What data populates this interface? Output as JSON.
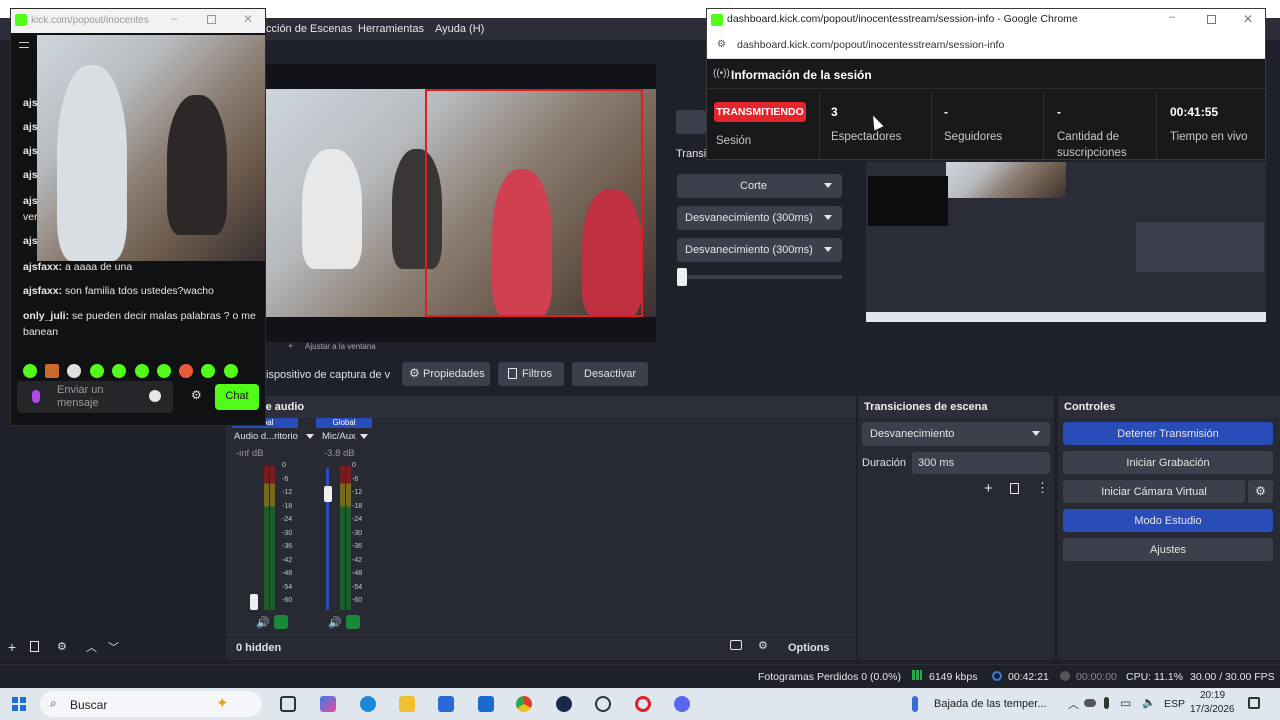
{
  "obs_menu": {
    "items": [
      "cción de Escenas",
      "Herramientas",
      "Ayuda (H)"
    ]
  },
  "chat_window": {
    "url": "kick.com/popout/inocentes",
    "messages": [
      {
        "user": "ajsfaxx:",
        "text": "a aaaa de una"
      },
      {
        "user": "ajsfaxx:",
        "text": "son familia tdos ustedes?wacho"
      },
      {
        "user": "only_juli:",
        "text": "se pueden decir malas palabras ? o me banean"
      }
    ],
    "partial_users": [
      "ajs",
      "ajs",
      "ajs",
      "ajs",
      "ajs",
      "ver",
      "ajs"
    ],
    "input_placeholder": "Enviar un mensaje",
    "chat_button": "Chat"
  },
  "chrome_window": {
    "title": "dashboard.kick.com/popout/inocentesstream/session-info - Google Chrome",
    "url": "dashboard.kick.com/popout/inocentesstream/session-info",
    "heading": "Información de la sesión",
    "status_badge": "TRANSMITIENDO",
    "session_label": "Sesión",
    "viewers_value": "3",
    "viewers_label": "Espectadores",
    "followers_value": "-",
    "followers_label": "Seguidores",
    "subs_value": "-",
    "subs_label_1": "Cantidad de",
    "subs_label_2": "suscripciones",
    "live_value": "00:41:55",
    "live_label": "Tiempo en vivo"
  },
  "studio": {
    "transition_label": "Transi",
    "cut_button": "Corte",
    "fade1": "Desvanecimiento (300ms)",
    "fade2": "Desvanecimiento (300ms)"
  },
  "preview_toolbar": {
    "fit_label": "Ajustar a la ventana"
  },
  "source_toolbar": {
    "source_name": "ispositivo de captura de v",
    "properties": "Propiedades",
    "filters": "Filtros",
    "deactivate": "Desactivar"
  },
  "audio_mixer": {
    "title": "ador de audio",
    "global1": "lobal",
    "global2": "Global",
    "ch1_name": "Audio d...ritorio",
    "ch1_db": "-inf dB",
    "ch2_name": "Mic/Aux",
    "ch2_db": "-3.8 dB",
    "scale": [
      "0",
      "-6",
      "-12",
      "-18",
      "-24",
      "-30",
      "-36",
      "-42",
      "-48",
      "-54",
      "-60"
    ],
    "hidden": "0 hidden",
    "options": "Options"
  },
  "transitions": {
    "title": "Transiciones de escena",
    "selected": "Desvanecimiento",
    "duration_label": "Duración",
    "duration_value": "300 ms"
  },
  "controls": {
    "title": "Controles",
    "stop_stream": "Detener Transmisión",
    "start_recording": "Iniciar Grabación",
    "virtual_cam": "Iniciar Cámara Virtual",
    "studio_mode": "Modo Estudio",
    "settings": "Ajustes"
  },
  "status_bar": {
    "dropped": "Fotogramas Perdidos 0 (0.0%)",
    "bitrate": "6149 kbps",
    "stream_time": "00:42:21",
    "rec_time": "00:00:00",
    "cpu": "CPU: 11.1%",
    "fps": "30.00 / 30.00 FPS"
  },
  "taskbar": {
    "search": "Buscar",
    "weather": "Bajada de las temper...",
    "lang": "ESP",
    "time": "20:19",
    "date": "17/3/2026"
  },
  "colors": {
    "obs_blue": "#284cb8",
    "kick_green": "#53fc18",
    "live_red": "#e2262b"
  }
}
